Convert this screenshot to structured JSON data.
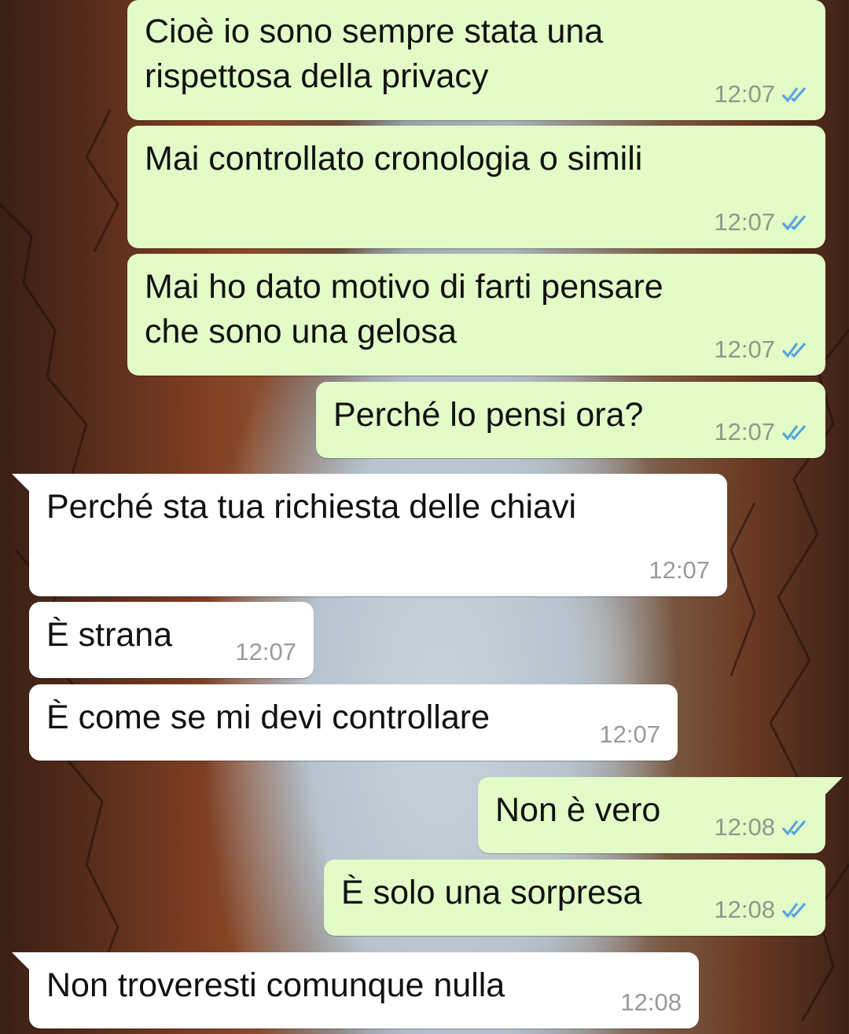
{
  "theme": {
    "outgoing_bubble": "#e2fbc7",
    "incoming_bubble": "#ffffff",
    "read_tick_color": "#4fa3e0"
  },
  "messages": [
    {
      "direction": "outgoing",
      "text": "Cioè io sono sempre stata una\nrispettosa della privacy",
      "time": "12:07",
      "status": "read-double-check-icon"
    },
    {
      "direction": "outgoing",
      "text": "Mai controllato cronologia o simili",
      "time": "12:07",
      "status": "read-double-check-icon"
    },
    {
      "direction": "outgoing",
      "text": "Mai ho dato motivo di farti pensare\nche sono una gelosa",
      "time": "12:07",
      "status": "read-double-check-icon"
    },
    {
      "direction": "outgoing",
      "text": "Perché lo pensi ora?",
      "time": "12:07",
      "status": "read-double-check-icon"
    },
    {
      "direction": "incoming",
      "text": "Perché sta tua richiesta delle chiavi",
      "time": "12:07"
    },
    {
      "direction": "incoming",
      "text": "È strana",
      "time": "12:07"
    },
    {
      "direction": "incoming",
      "text": "È come se mi devi controllare",
      "time": "12:07"
    },
    {
      "direction": "outgoing",
      "text": "Non è vero",
      "time": "12:08",
      "status": "read-double-check-icon"
    },
    {
      "direction": "outgoing",
      "text": "È solo una sorpresa",
      "time": "12:08",
      "status": "read-double-check-icon"
    },
    {
      "direction": "incoming",
      "text": "Non troveresti comunque nulla",
      "time": "12:08"
    }
  ]
}
